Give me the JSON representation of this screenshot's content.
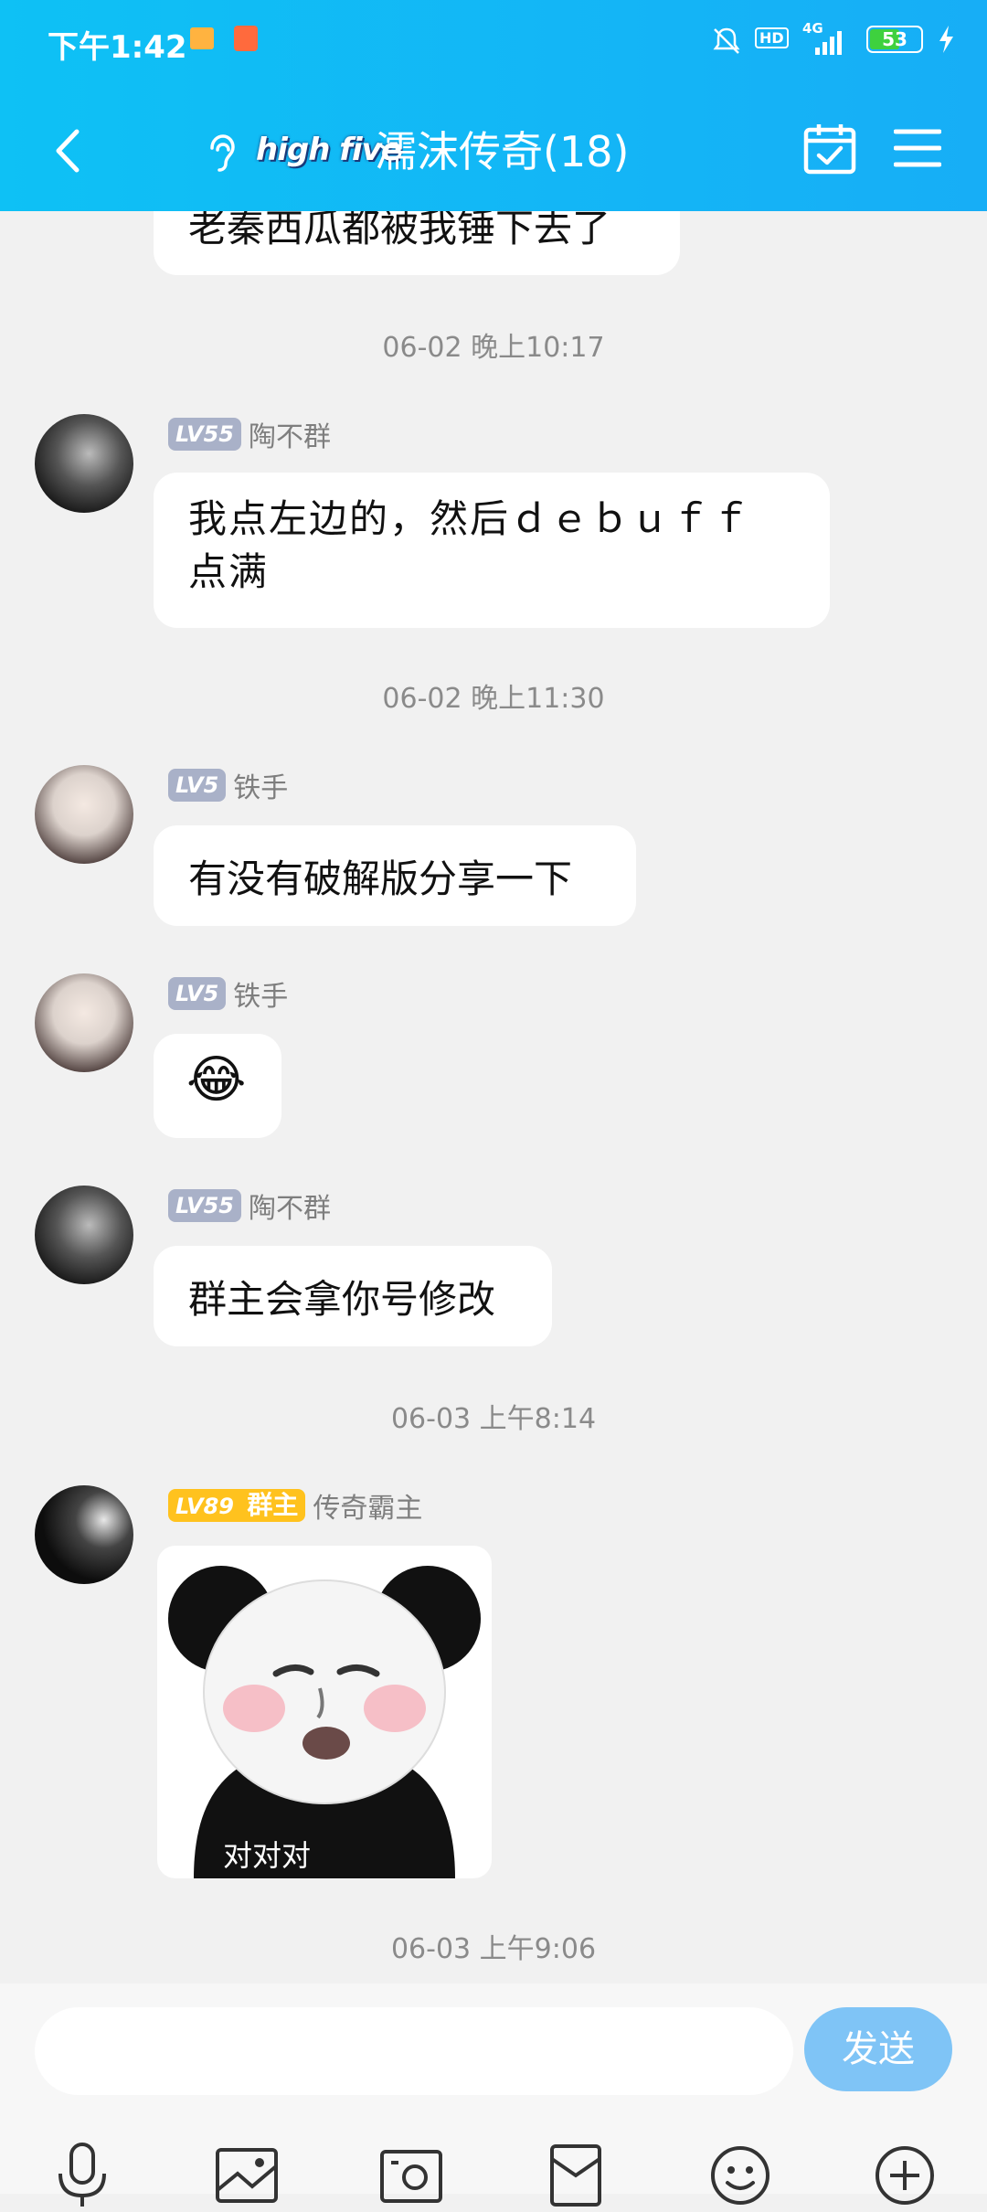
{
  "status_bar": {
    "time": "下午1:42",
    "battery": "53",
    "network": "4G",
    "hd": "HD"
  },
  "header": {
    "brand": "high five",
    "title": "濡沫传奇(18)"
  },
  "chat": {
    "partial_message": "老秦西瓜都被我锤下去了",
    "messages": [
      {
        "time": "06-02 晚上10:17",
        "level": "LV55",
        "nick": "陶不群",
        "text": "我点左边的，然后ｄｅｂｕｆｆ点满",
        "line1": "我点左边的，然后ｄｅｂｕｆｆ",
        "line2": "点满"
      },
      {
        "time": "06-02 晚上11:30",
        "level": "LV5",
        "nick": "铁手",
        "text": "有没有破解版分享一下"
      },
      {
        "level": "LV5",
        "nick": "铁手",
        "emoji": "😂"
      },
      {
        "level": "LV55",
        "nick": "陶不群",
        "text": "群主会拿你号修改"
      },
      {
        "time": "06-03 上午8:14",
        "level": "LV89",
        "role": "群主",
        "nick": "传奇霸主",
        "sticker_caption": "对对对"
      },
      {
        "time": "06-03 上午9:06"
      }
    ]
  },
  "footer": {
    "send_label": "发送",
    "input_value": ""
  }
}
